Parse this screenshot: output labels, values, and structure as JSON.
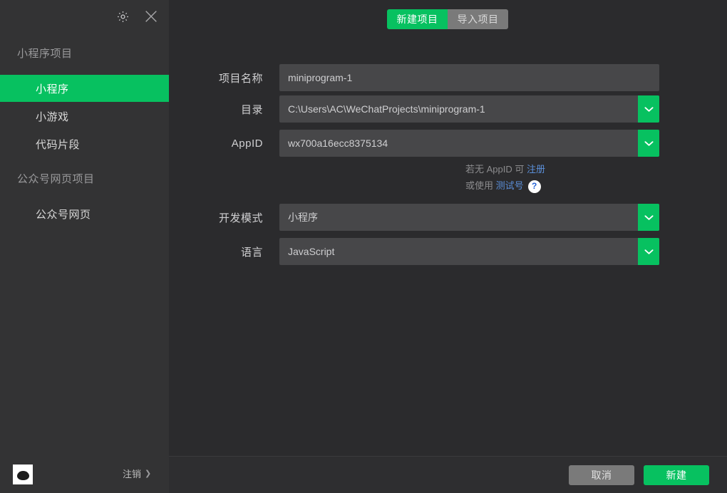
{
  "window": {
    "settings_icon": "gear-icon",
    "close_icon": "close-icon"
  },
  "sidebar": {
    "sections": [
      {
        "label": "小程序项目"
      },
      {
        "label": "公众号网页项目"
      }
    ],
    "items": [
      {
        "label": "小程序",
        "active": true
      },
      {
        "label": "小游戏",
        "active": false
      },
      {
        "label": "代码片段",
        "active": false
      },
      {
        "label": "公众号网页",
        "active": false
      }
    ],
    "footer": {
      "logout_label": "注销",
      "logout_chevron": "chevron-right-icon",
      "avatar": "user-avatar"
    }
  },
  "main": {
    "tabs": [
      {
        "label": "新建项目",
        "active": true
      },
      {
        "label": "导入项目",
        "active": false
      }
    ],
    "form": {
      "project_name": {
        "label": "项目名称",
        "value": "miniprogram-1"
      },
      "directory": {
        "label": "目录",
        "value": "C:\\Users\\AC\\WeChatProjects\\miniprogram-1"
      },
      "appid": {
        "label": "AppID",
        "value": "wx700a16ecc8375134"
      },
      "dev_mode": {
        "label": "开发模式",
        "value": "小程序"
      },
      "language": {
        "label": "语言",
        "value": "JavaScript"
      }
    },
    "appid_help": {
      "line1_prefix": "若无 AppID 可 ",
      "line1_link": "注册",
      "line2_prefix": "或使用 ",
      "line2_link": "测试号",
      "question_mark": "?"
    }
  },
  "footer": {
    "cancel_label": "取消",
    "create_label": "新建"
  },
  "colors": {
    "accent_green": "#07c160",
    "sidebar_bg": "#333334",
    "panel_bg": "#2b2b2d",
    "field_bg": "#474749",
    "link_blue": "#5b8fd9"
  }
}
